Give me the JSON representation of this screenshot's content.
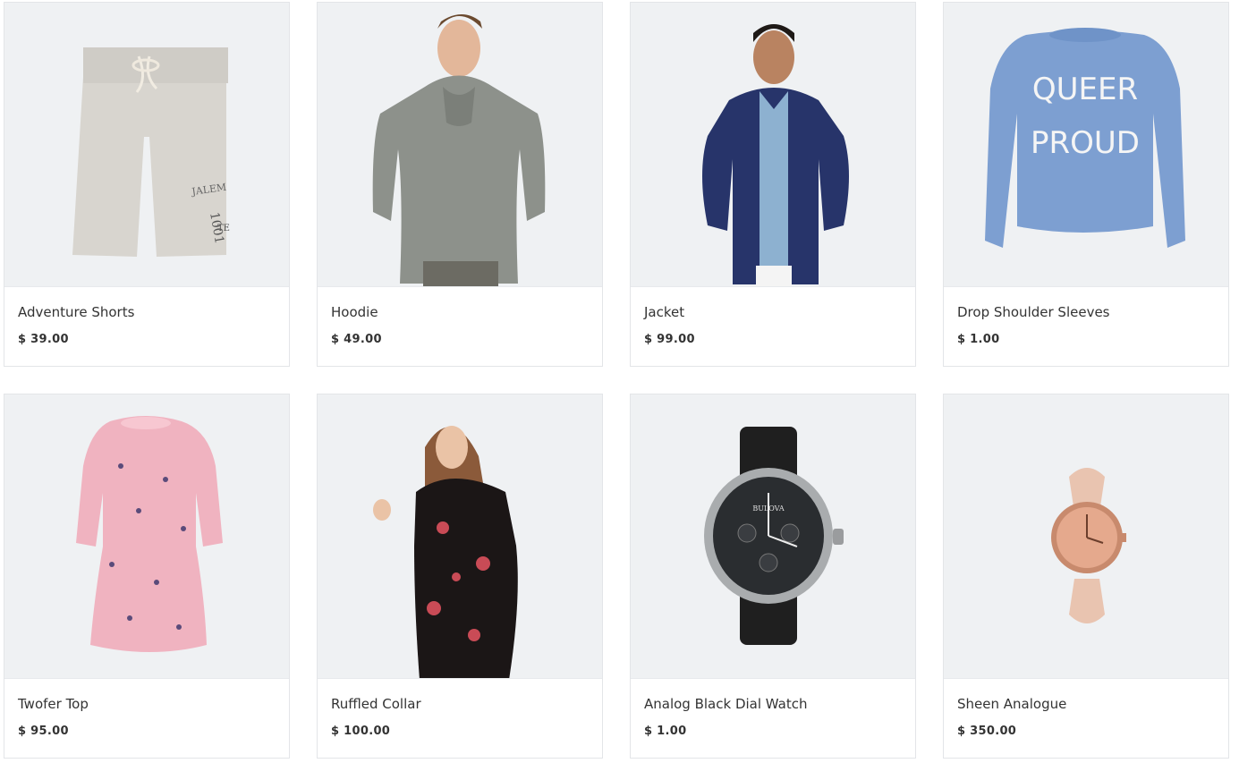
{
  "products": [
    {
      "name": "Adventure Shorts",
      "price": "$ 39.00",
      "image_icon": "shorts-image"
    },
    {
      "name": "Hoodie",
      "price": "$ 49.00",
      "image_icon": "hoodie-image"
    },
    {
      "name": "Jacket",
      "price": "$ 99.00",
      "image_icon": "jacket-image"
    },
    {
      "name": "Drop Shoulder Sleeves",
      "price": "$ 1.00",
      "image_icon": "sweater-image",
      "print_text": [
        "QUEER",
        "PROUD"
      ]
    },
    {
      "name": "Twofer Top",
      "price": "$ 95.00",
      "image_icon": "dress-image"
    },
    {
      "name": "Ruffled Collar",
      "price": "$ 100.00",
      "image_icon": "floral-dress-image"
    },
    {
      "name": "Analog Black Dial Watch",
      "price": "$ 1.00",
      "image_icon": "black-watch-image",
      "brand": "BULOVA"
    },
    {
      "name": "Sheen Analogue",
      "price": "$ 350.00",
      "image_icon": "rose-gold-watch-image"
    }
  ]
}
